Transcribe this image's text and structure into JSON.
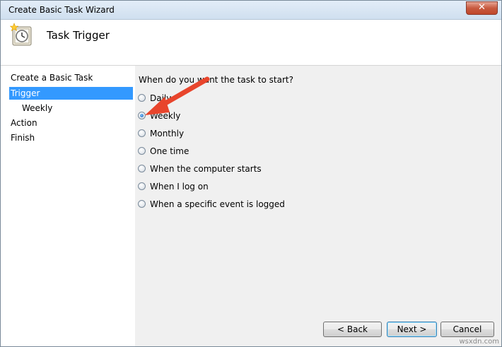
{
  "window": {
    "title": "Create Basic Task Wizard",
    "close_label": "✕",
    "header_title": "Task Trigger"
  },
  "nav": {
    "items": [
      {
        "label": "Create a Basic Task",
        "selected": false
      },
      {
        "label": "Trigger",
        "selected": true
      },
      {
        "label": "Weekly",
        "selected": false
      },
      {
        "label": "Action",
        "selected": false
      },
      {
        "label": "Finish",
        "selected": false
      }
    ]
  },
  "main": {
    "question": "When do you want the task to start?",
    "options": [
      {
        "label": "Daily",
        "checked": false
      },
      {
        "label": "Weekly",
        "checked": true
      },
      {
        "label": "Monthly",
        "checked": false
      },
      {
        "label": "One time",
        "checked": false
      },
      {
        "label": "When the computer starts",
        "checked": false
      },
      {
        "label": "When I log on",
        "checked": false
      },
      {
        "label": "When a specific event is logged",
        "checked": false
      }
    ]
  },
  "buttons": {
    "back": "< Back",
    "next": "Next >",
    "cancel": "Cancel"
  },
  "annotation": {
    "arrow_color": "#e8452c"
  },
  "watermark": "wsxdn.com"
}
